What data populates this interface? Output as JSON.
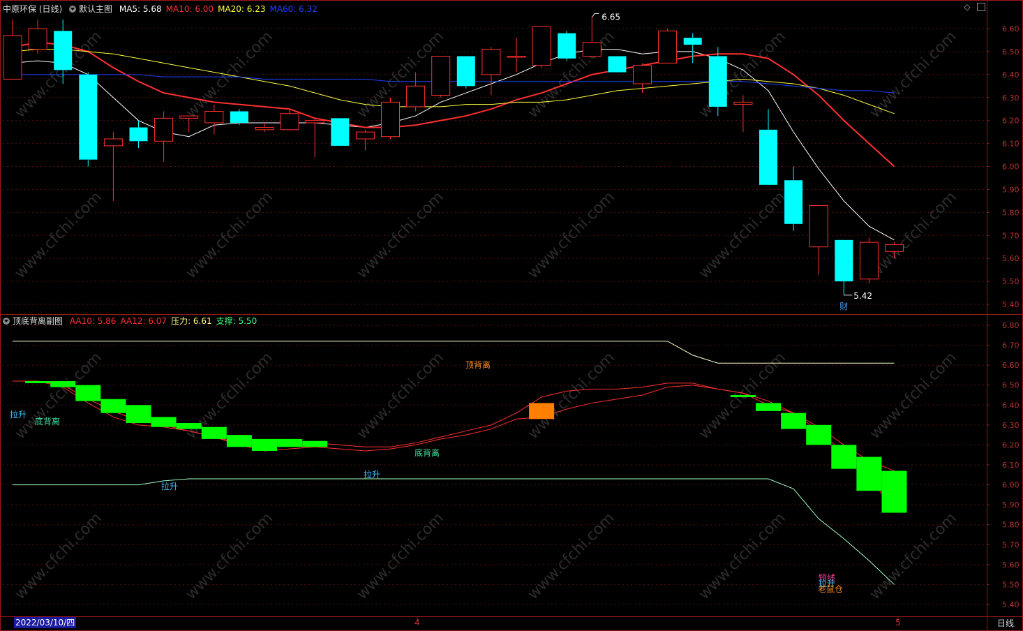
{
  "main_panel": {
    "stock_title": "中原环保 (日线)",
    "template_name": "默认主图",
    "indicators": [
      {
        "text": "MA5: 5.68",
        "color": "#ffffff"
      },
      {
        "text": "MA10: 6.00",
        "color": "#ff3030"
      },
      {
        "text": "MA20: 6.23",
        "color": "#ffff40"
      },
      {
        "text": "MA60: 6.32",
        "color": "#2040ff"
      }
    ],
    "high_marker": "6.65",
    "low_marker": "5.42",
    "finance_marker": "财",
    "y_ticks": [
      "6.60",
      "6.50",
      "6.40",
      "6.30",
      "6.20",
      "6.10",
      "6.00",
      "5.90",
      "5.80",
      "5.70",
      "5.60",
      "5.50",
      "5.40"
    ]
  },
  "sub_panel": {
    "title": "顶底背离副图",
    "indicators": [
      {
        "text": "AA10: 5.86",
        "color": "#ff3030"
      },
      {
        "text": "AA12: 6.07",
        "color": "#ff3030"
      },
      {
        "text": "压力: 6.61",
        "color": "#ffff80"
      },
      {
        "text": "支撑: 5.50",
        "color": "#40ff80"
      }
    ],
    "labels": [
      {
        "text": "顶背离",
        "color": "#ff8c1a"
      },
      {
        "text": "拉升",
        "color": "#40c0ff"
      },
      {
        "text": "底背离",
        "color": "#40e0a0"
      },
      {
        "text": "底背离",
        "color": "#40e0a0"
      },
      {
        "text": "拉升",
        "color": "#40c0ff"
      },
      {
        "text": "拉升",
        "color": "#40c0ff"
      },
      {
        "text": "短线",
        "color": "#ff40a0"
      },
      {
        "text": "拉升",
        "color": "#40c0ff"
      },
      {
        "text": "老鼠仓",
        "color": "#ff8c1a"
      }
    ],
    "y_ticks": [
      "6.80",
      "6.70",
      "6.60",
      "6.50",
      "6.40",
      "6.30",
      "6.20",
      "6.10",
      "6.00",
      "5.90",
      "5.80",
      "5.70",
      "5.60",
      "5.50",
      "5.40"
    ]
  },
  "x_axis": {
    "cursor_date": "2022/03/10/四",
    "month_labels": [
      "4",
      "5"
    ],
    "period": "日线"
  },
  "watermark": "www.cfchi.com",
  "chart_data": [
    {
      "type": "candlestick",
      "title": "中原环保 (日线)",
      "price_range": [
        5.37,
        6.67
      ],
      "up_color": "#ff3030",
      "down_color": "#00ffff",
      "candles": [
        {
          "o": 6.38,
          "h": 6.64,
          "l": 6.38,
          "c": 6.57
        },
        {
          "o": 6.51,
          "h": 6.64,
          "l": 6.49,
          "c": 6.6
        },
        {
          "o": 6.59,
          "h": 6.64,
          "l": 6.36,
          "c": 6.42
        },
        {
          "o": 6.4,
          "h": 6.41,
          "l": 6.0,
          "c": 6.03
        },
        {
          "o": 6.09,
          "h": 6.15,
          "l": 5.85,
          "c": 6.12
        },
        {
          "o": 6.17,
          "h": 6.2,
          "l": 6.08,
          "c": 6.11
        },
        {
          "o": 6.11,
          "h": 6.24,
          "l": 6.02,
          "c": 6.21
        },
        {
          "o": 6.21,
          "h": 6.22,
          "l": 6.15,
          "c": 6.22
        },
        {
          "o": 6.19,
          "h": 6.27,
          "l": 6.14,
          "c": 6.24
        },
        {
          "o": 6.24,
          "h": 6.25,
          "l": 6.18,
          "c": 6.19
        },
        {
          "o": 6.16,
          "h": 6.19,
          "l": 6.15,
          "c": 6.17
        },
        {
          "o": 6.16,
          "h": 6.25,
          "l": 6.16,
          "c": 6.23
        },
        {
          "o": 6.19,
          "h": 6.21,
          "l": 6.04,
          "c": 6.2
        },
        {
          "o": 6.21,
          "h": 6.21,
          "l": 6.09,
          "c": 6.09
        },
        {
          "o": 6.12,
          "h": 6.16,
          "l": 6.07,
          "c": 6.15
        },
        {
          "o": 6.13,
          "h": 6.3,
          "l": 6.12,
          "c": 6.28
        },
        {
          "o": 6.26,
          "h": 6.41,
          "l": 6.24,
          "c": 6.35
        },
        {
          "o": 6.31,
          "h": 6.48,
          "l": 6.3,
          "c": 6.48
        },
        {
          "o": 6.48,
          "h": 6.48,
          "l": 6.34,
          "c": 6.35
        },
        {
          "o": 6.4,
          "h": 6.52,
          "l": 6.31,
          "c": 6.51
        },
        {
          "o": 6.48,
          "h": 6.56,
          "l": 6.41,
          "c": 6.48
        },
        {
          "o": 6.44,
          "h": 6.61,
          "l": 6.43,
          "c": 6.61
        },
        {
          "o": 6.58,
          "h": 6.59,
          "l": 6.46,
          "c": 6.47
        },
        {
          "o": 6.48,
          "h": 6.65,
          "l": 6.48,
          "c": 6.54
        },
        {
          "o": 6.48,
          "h": 6.48,
          "l": 6.41,
          "c": 6.41
        },
        {
          "o": 6.36,
          "h": 6.45,
          "l": 6.32,
          "c": 6.44
        },
        {
          "o": 6.45,
          "h": 6.6,
          "l": 6.45,
          "c": 6.59
        },
        {
          "o": 6.56,
          "h": 6.58,
          "l": 6.45,
          "c": 6.53
        },
        {
          "o": 6.48,
          "h": 6.52,
          "l": 6.22,
          "c": 6.26
        },
        {
          "o": 6.27,
          "h": 6.31,
          "l": 6.15,
          "c": 6.28
        },
        {
          "o": 6.16,
          "h": 6.25,
          "l": 5.92,
          "c": 5.92
        },
        {
          "o": 5.94,
          "h": 6.0,
          "l": 5.72,
          "c": 5.75
        },
        {
          "o": 5.65,
          "h": 5.83,
          "l": 5.53,
          "c": 5.83
        },
        {
          "o": 5.68,
          "h": 5.68,
          "l": 5.44,
          "c": 5.5
        },
        {
          "o": 5.51,
          "h": 5.69,
          "l": 5.49,
          "c": 5.67
        },
        {
          "o": 5.63,
          "h": 5.67,
          "l": 5.6,
          "c": 5.66
        }
      ],
      "series": [
        {
          "name": "MA5",
          "color": "#ffffff",
          "values": [
            6.45,
            6.46,
            6.45,
            6.4,
            6.3,
            6.2,
            6.15,
            6.13,
            6.18,
            6.19,
            6.19,
            6.19,
            6.19,
            6.18,
            6.17,
            6.19,
            6.22,
            6.28,
            6.32,
            6.36,
            6.4,
            6.45,
            6.49,
            6.51,
            6.51,
            6.49,
            6.5,
            6.5,
            6.47,
            6.42,
            6.33,
            6.15,
            5.99,
            5.85,
            5.74,
            5.68
          ]
        },
        {
          "name": "MA10",
          "color": "#ff3030",
          "values": [
            6.52,
            6.54,
            6.53,
            6.5,
            6.43,
            6.37,
            6.32,
            6.3,
            6.28,
            6.27,
            6.26,
            6.25,
            6.21,
            6.19,
            6.17,
            6.17,
            6.18,
            6.2,
            6.22,
            6.25,
            6.29,
            6.32,
            6.36,
            6.4,
            6.42,
            6.44,
            6.46,
            6.48,
            6.49,
            6.49,
            6.47,
            6.4,
            6.31,
            6.2,
            6.1,
            6.0
          ]
        },
        {
          "name": "MA20",
          "color": "#ffff40",
          "values": [
            6.5,
            6.51,
            6.51,
            6.5,
            6.49,
            6.47,
            6.45,
            6.43,
            6.41,
            6.39,
            6.37,
            6.35,
            6.32,
            6.29,
            6.27,
            6.26,
            6.26,
            6.26,
            6.27,
            6.27,
            6.28,
            6.28,
            6.29,
            6.31,
            6.33,
            6.34,
            6.35,
            6.36,
            6.37,
            6.38,
            6.37,
            6.36,
            6.34,
            6.31,
            6.27,
            6.23
          ]
        },
        {
          "name": "MA60",
          "color": "#2040ff",
          "values": [
            6.4,
            6.4,
            6.4,
            6.4,
            6.4,
            6.4,
            6.39,
            6.39,
            6.39,
            6.39,
            6.38,
            6.38,
            6.38,
            6.38,
            6.38,
            6.37,
            6.37,
            6.37,
            6.37,
            6.37,
            6.37,
            6.37,
            6.37,
            6.37,
            6.37,
            6.37,
            6.37,
            6.37,
            6.37,
            6.37,
            6.36,
            6.35,
            6.34,
            6.33,
            6.33,
            6.32
          ]
        }
      ]
    },
    {
      "type": "line",
      "title": "顶底背离副图",
      "y_range": [
        5.35,
        6.85
      ],
      "series": [
        {
          "name": "压力",
          "color": "#ffffcc",
          "values": [
            6.72,
            6.72,
            6.72,
            6.72,
            6.72,
            6.72,
            6.72,
            6.72,
            6.72,
            6.72,
            6.72,
            6.72,
            6.72,
            6.72,
            6.72,
            6.72,
            6.72,
            6.72,
            6.72,
            6.72,
            6.72,
            6.72,
            6.72,
            6.72,
            6.72,
            6.72,
            6.72,
            6.65,
            6.61,
            6.61,
            6.61,
            6.61,
            6.61,
            6.61,
            6.61,
            6.61
          ]
        },
        {
          "name": "支撑",
          "color": "#a0ffc0",
          "values": [
            6.0,
            6.0,
            6.0,
            6.0,
            6.0,
            6.0,
            6.02,
            6.03,
            6.03,
            6.03,
            6.03,
            6.03,
            6.03,
            6.03,
            6.03,
            6.03,
            6.03,
            6.03,
            6.03,
            6.03,
            6.03,
            6.03,
            6.03,
            6.03,
            6.03,
            6.03,
            6.03,
            6.03,
            6.03,
            6.03,
            6.03,
            5.98,
            5.83,
            5.73,
            5.62,
            5.5
          ]
        },
        {
          "name": "AA10",
          "color": "#ff3030",
          "values": [
            6.52,
            6.52,
            6.5,
            6.43,
            6.37,
            6.32,
            6.3,
            6.27,
            6.24,
            6.21,
            6.19,
            6.2,
            6.21,
            6.2,
            6.19,
            6.19,
            6.21,
            6.24,
            6.27,
            6.3,
            6.36,
            6.44,
            6.47,
            6.48,
            6.48,
            6.49,
            6.51,
            6.51,
            6.48,
            6.46,
            6.42,
            6.36,
            6.27,
            6.16,
            6.05,
            5.86
          ]
        },
        {
          "name": "AA12",
          "color": "#ff3030",
          "values": [
            6.52,
            6.52,
            6.49,
            6.41,
            6.34,
            6.3,
            6.29,
            6.27,
            6.24,
            6.2,
            6.17,
            6.18,
            6.19,
            6.18,
            6.17,
            6.18,
            6.2,
            6.23,
            6.25,
            6.28,
            6.33,
            6.34,
            6.38,
            6.41,
            6.43,
            6.45,
            6.49,
            6.5,
            6.48,
            6.46,
            6.4,
            6.36,
            6.29,
            6.2,
            6.12,
            6.07
          ]
        }
      ],
      "histogram": [
        {
          "i": 1,
          "from": 6.52,
          "to": 6.51,
          "color": "#00ff00"
        },
        {
          "i": 2,
          "from": 6.52,
          "to": 6.49,
          "color": "#00ff00"
        },
        {
          "i": 3,
          "from": 6.5,
          "to": 6.42,
          "color": "#00ff00"
        },
        {
          "i": 4,
          "from": 6.43,
          "to": 6.36,
          "color": "#00ff00"
        },
        {
          "i": 5,
          "from": 6.4,
          "to": 6.31,
          "color": "#00ff00"
        },
        {
          "i": 6,
          "from": 6.34,
          "to": 6.29,
          "color": "#00ff00"
        },
        {
          "i": 7,
          "from": 6.31,
          "to": 6.28,
          "color": "#00ff00"
        },
        {
          "i": 8,
          "from": 6.29,
          "to": 6.23,
          "color": "#00ff00"
        },
        {
          "i": 9,
          "from": 6.25,
          "to": 6.19,
          "color": "#00ff00"
        },
        {
          "i": 10,
          "from": 6.23,
          "to": 6.17,
          "color": "#00ff00"
        },
        {
          "i": 11,
          "from": 6.23,
          "to": 6.19,
          "color": "#00ff00"
        },
        {
          "i": 12,
          "from": 6.22,
          "to": 6.19,
          "color": "#00ff00"
        },
        {
          "i": 21,
          "from": 6.41,
          "to": 6.33,
          "color": "#ff8000"
        },
        {
          "i": 29,
          "from": 6.45,
          "to": 6.44,
          "color": "#00ff00"
        },
        {
          "i": 30,
          "from": 6.41,
          "to": 6.37,
          "color": "#00ff00"
        },
        {
          "i": 31,
          "from": 6.36,
          "to": 6.28,
          "color": "#00ff00"
        },
        {
          "i": 32,
          "from": 6.3,
          "to": 6.2,
          "color": "#00ff00"
        },
        {
          "i": 33,
          "from": 6.2,
          "to": 6.08,
          "color": "#00ff00"
        },
        {
          "i": 34,
          "from": 6.14,
          "to": 5.97,
          "color": "#00ff00"
        },
        {
          "i": 35,
          "from": 6.07,
          "to": 5.86,
          "color": "#00ff00"
        }
      ]
    }
  ]
}
